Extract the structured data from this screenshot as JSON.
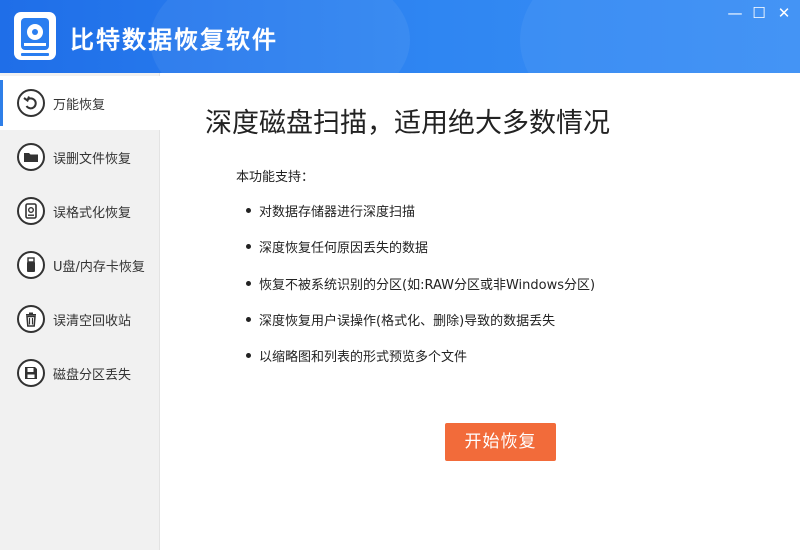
{
  "app": {
    "title": "比特数据恢复软件",
    "logo_icon": "disk-recovery-logo"
  },
  "window_controls": {
    "minimize": "—",
    "maximize": "☐",
    "close": "✕"
  },
  "sidebar": {
    "items": [
      {
        "label": "万能恢复",
        "icon": "refresh-icon",
        "active": true
      },
      {
        "label": "误删文件恢复",
        "icon": "folder-icon",
        "active": false
      },
      {
        "label": "误格式化恢复",
        "icon": "hard-drive-icon",
        "active": false
      },
      {
        "label": "U盘/内存卡恢复",
        "icon": "usb-icon",
        "active": false
      },
      {
        "label": "误清空回收站",
        "icon": "trash-icon",
        "active": false
      },
      {
        "label": "磁盘分区丢失",
        "icon": "floppy-icon",
        "active": false
      }
    ]
  },
  "main": {
    "title": "深度磁盘扫描，适用绝大多数情况",
    "support_label": "本功能支持：",
    "features": [
      "对数据存储器进行深度扫描",
      "深度恢复任何原因丢失的数据",
      "恢复不被系统识别的分区(如:RAW分区或非Windows分区)",
      "深度恢复用户误操作(格式化、删除)导致的数据丢失",
      "以缩略图和列表的形式预览多个文件"
    ],
    "start_button": "开始恢复"
  },
  "colors": {
    "header": "#2a7ef0",
    "accent": "#2f7fe8",
    "start_button": "#f26b3a",
    "sidebar_bg": "#f1f1f1"
  }
}
